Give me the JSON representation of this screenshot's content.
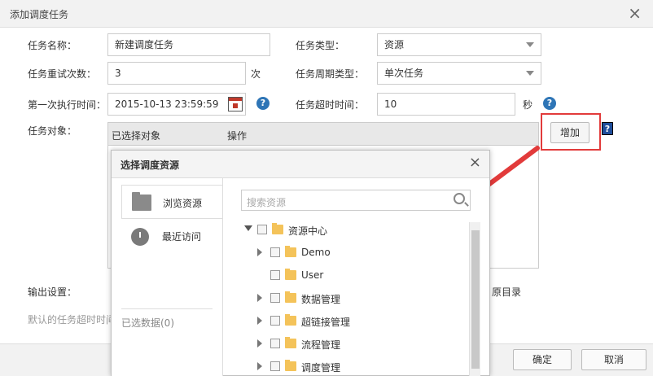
{
  "window": {
    "title": "添加调度任务",
    "close": "×"
  },
  "form": {
    "task_name_label": "任务名称：",
    "task_name_value": "新建调度任务",
    "task_type_label": "任务类型：",
    "task_type_value": "资源",
    "retry_label": "任务重试次数：",
    "retry_value": "3",
    "retry_unit": "次",
    "cycle_label": "任务周期类型：",
    "cycle_value": "单次任务",
    "first_exec_label": "第一次执行时间：",
    "first_exec_value": "2015-10-13 23:59:59",
    "timeout_label": "任务超时时间：",
    "timeout_value": "10",
    "timeout_unit": "秒",
    "object_label": "任务对象：",
    "object_col1": "已选择对象",
    "object_col2": "操作",
    "add_button": "增加",
    "help_mark": "?",
    "output_label": "输出设置：",
    "output_right": "原目录",
    "default_note": "默认的任务超时时间"
  },
  "footer": {
    "ok": "确定",
    "cancel": "取消"
  },
  "modal": {
    "title": "选择调度资源",
    "close": "×",
    "side": {
      "browse": "浏览资源",
      "recent": "最近访问",
      "selected_count": "已选数据(0)"
    },
    "search_placeholder": "搜索资源",
    "tree": [
      {
        "label": "资源中心",
        "toggle": "open"
      },
      {
        "label": "Demo",
        "toggle": "closed"
      },
      {
        "label": "User",
        "toggle": "none"
      },
      {
        "label": "数据管理",
        "toggle": "closed"
      },
      {
        "label": "超链接管理",
        "toggle": "closed"
      },
      {
        "label": "流程管理",
        "toggle": "closed"
      },
      {
        "label": "调度管理",
        "toggle": "closed"
      }
    ]
  },
  "colors": {
    "accent": "#2e75b6",
    "highlight": "#e23b3b",
    "folder": "#f4c35a"
  }
}
